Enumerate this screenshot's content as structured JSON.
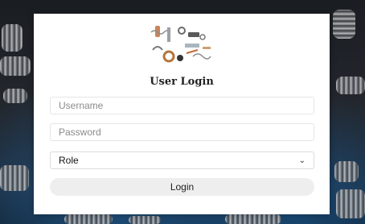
{
  "login": {
    "title": "User Login",
    "username_placeholder": "Username",
    "password_placeholder": "Password",
    "role_selected": "Role",
    "login_label": "Login"
  },
  "colors": {
    "card_background": "#ffffff",
    "button_background": "#eeeeee",
    "page_background": "#1a1d22",
    "accent_blue": "#2878be"
  },
  "icons": {
    "logo": "springs-logo-icon",
    "select_arrow": "chevron-down-icon"
  }
}
